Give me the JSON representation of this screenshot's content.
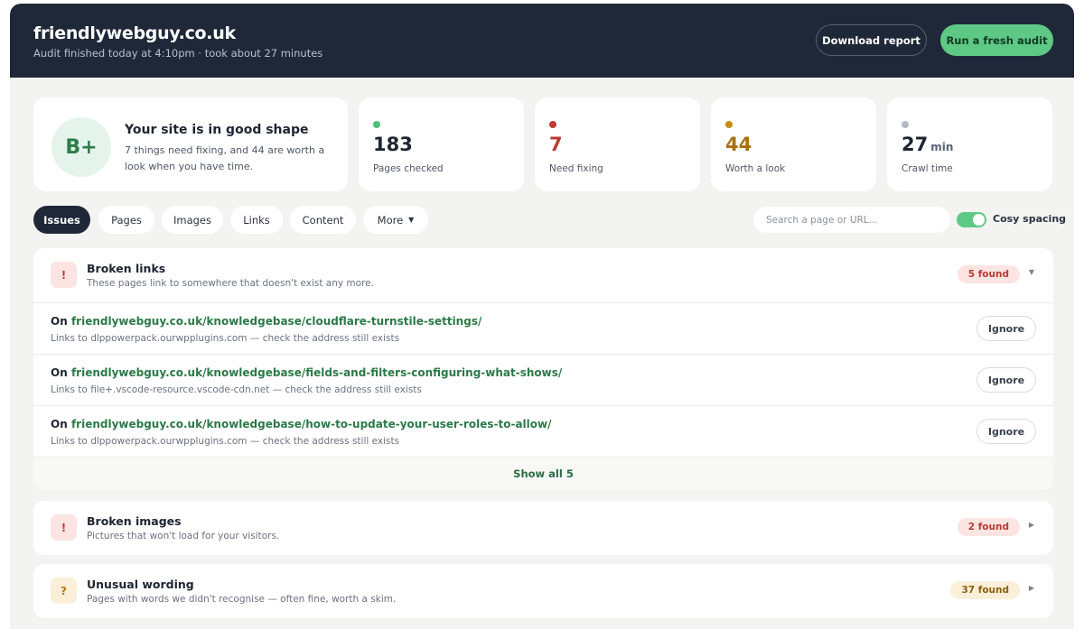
{
  "header": {
    "site": "friendlywebguy.co.uk",
    "subtitle": "Audit finished today at 4:10pm · took about 27 minutes",
    "download_label": "Download report",
    "run_label": "Run a fresh audit"
  },
  "summary": {
    "grade": "B+",
    "title": "Your site is in good shape",
    "description": "7 things need fixing, and 44 are worth a look when you have time."
  },
  "stats": [
    {
      "value": "183",
      "unit": "",
      "label": "Pages checked",
      "color": "#4cbf78"
    },
    {
      "value": "7",
      "unit": "",
      "label": "Need fixing",
      "color": "#c63b32"
    },
    {
      "value": "44",
      "unit": "",
      "label": "Worth a look",
      "color": "#c98a14"
    },
    {
      "value": "27",
      "unit": "min",
      "label": "Crawl time",
      "color": "#b5bac2"
    }
  ],
  "tabs": {
    "issues": "Issues",
    "pages": "Pages",
    "images": "Images",
    "links": "Links",
    "content": "Content",
    "more": "More"
  },
  "search": {
    "placeholder": "Search a page or URL..."
  },
  "toggle": {
    "label": "Cosy spacing",
    "on": true
  },
  "issues": [
    {
      "title": "Broken links",
      "desc": "These pages link to somewhere that doesn't exist any more.",
      "badge": "5 found",
      "icon": "!",
      "severity_color": "#c63b32",
      "expanded": true,
      "rows": [
        {
          "prefix": "On",
          "url": "friendlywebguy.co.uk/knowledgebase/cloudflare-turnstile-settings/",
          "sub": "Links to dlppowerpack.ourwpplugins.com — check the address still exists",
          "action": "Ignore"
        },
        {
          "prefix": "On",
          "url": "friendlywebguy.co.uk/knowledgebase/fields-and-filters-configuring-what-shows/",
          "sub": "Links to file+.vscode-resource.vscode-cdn.net — check the address still exists",
          "action": "Ignore"
        },
        {
          "prefix": "On",
          "url": "friendlywebguy.co.uk/knowledgebase/how-to-update-your-user-roles-to-allow/",
          "sub": "Links to dlppowerpack.ourwpplugins.com — check the address still exists",
          "action": "Ignore"
        }
      ],
      "show_all": "Show all 5"
    },
    {
      "title": "Broken images",
      "desc": "Pictures that won't load for your visitors.",
      "badge": "2 found",
      "icon": "!",
      "severity_color": "#c63b32",
      "expanded": false
    },
    {
      "title": "Unusual wording",
      "desc": "Pages with words we didn't recognise — often fine, worth a skim.",
      "badge": "37 found",
      "icon": "?",
      "severity_color": "#b07a14",
      "expanded": false
    }
  ]
}
